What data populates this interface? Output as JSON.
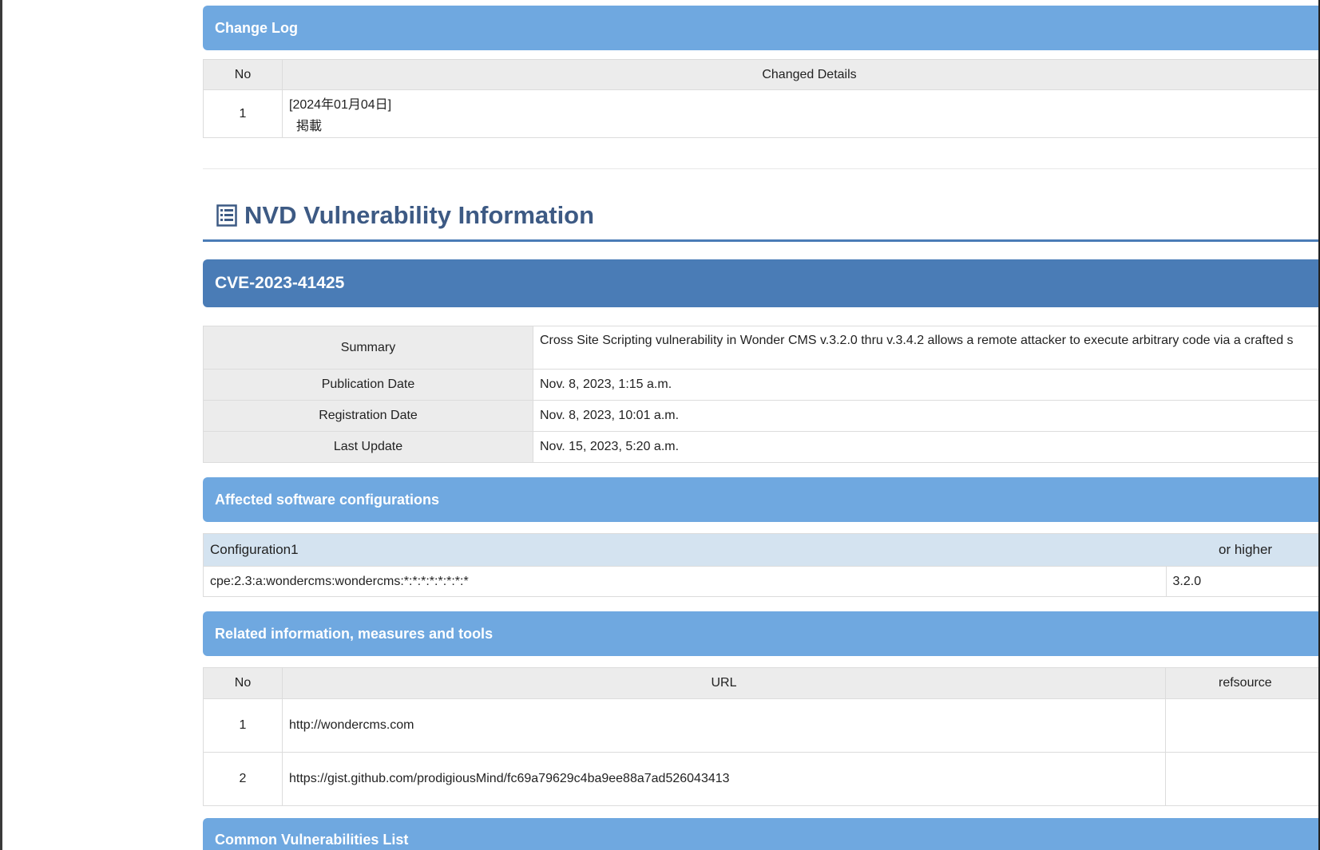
{
  "change_log": {
    "title": "Change Log",
    "headers": [
      "No",
      "Changed Details"
    ],
    "rows": [
      {
        "no": "1",
        "date": "[2024年01月04日]",
        "detail": "掲載"
      }
    ]
  },
  "nvd": {
    "heading": "NVD Vulnerability Information",
    "icon": "list-icon",
    "cve_id": "CVE-2023-41425",
    "summary_label": "Summary",
    "summary": "Cross Site Scripting vulnerability in Wonder CMS v.3.2.0 thru v.3.4.2 allows a remote attacker to execute arbitrary code via a crafted s",
    "publication_label": "Publication Date",
    "publication_date": "Nov. 8, 2023, 1:15 a.m.",
    "registration_label": "Registration Date",
    "registration_date": "Nov. 8, 2023, 10:01 a.m.",
    "update_label": "Last Update",
    "last_update": "Nov. 15, 2023, 5:20 a.m."
  },
  "affected": {
    "title": "Affected software configurations",
    "config_label": "Configuration1",
    "higher_label": "or higher",
    "cpe": "cpe:2.3:a:wondercms:wondercms:*:*:*:*:*:*:*:*",
    "version": "3.2.0"
  },
  "related": {
    "title": "Related information, measures and tools",
    "headers": [
      "No",
      "URL",
      "refsource"
    ],
    "rows": [
      {
        "no": "1",
        "url": "http://wondercms.com",
        "refsource": ""
      },
      {
        "no": "2",
        "url": "https://gist.github.com/prodigiousMind/fc69a79629c4ba9ee88a7ad526043413",
        "refsource": ""
      }
    ]
  },
  "common": {
    "title": "Common Vulnerabilities List"
  },
  "colors": {
    "section_bar": "#6fa8e0",
    "cve_bar": "#4a7cb6",
    "heading_text": "#3d5a84",
    "header_cell": "#ececec",
    "config_header": "#d4e3f0"
  }
}
